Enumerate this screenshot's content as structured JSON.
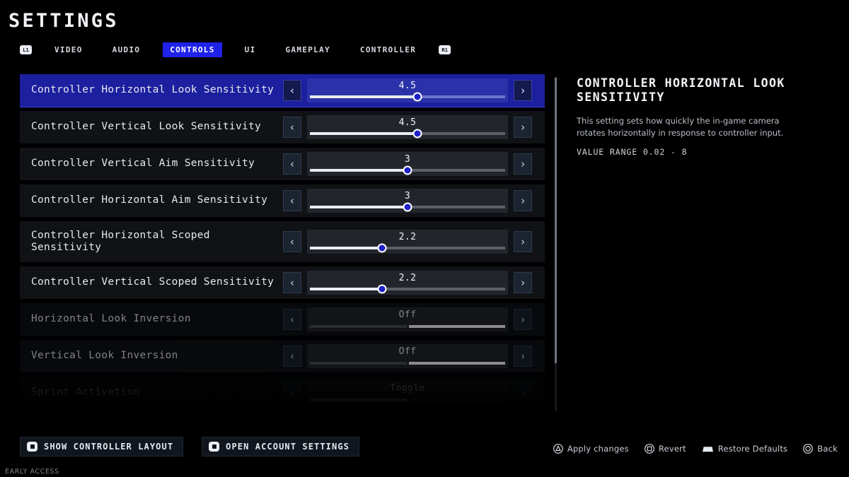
{
  "header": {
    "title": "SETTINGS",
    "left_bumper": "L1",
    "right_bumper": "R1",
    "tabs": [
      {
        "label": "VIDEO",
        "active": false
      },
      {
        "label": "AUDIO",
        "active": false
      },
      {
        "label": "CONTROLS",
        "active": true
      },
      {
        "label": "UI",
        "active": false
      },
      {
        "label": "GAMEPLAY",
        "active": false
      },
      {
        "label": "CONTROLLER",
        "active": false
      }
    ],
    "accent_color": "#1f22e8"
  },
  "settings": {
    "rows": [
      {
        "label": "Controller Horizontal Look Sensitivity",
        "value": "4.5",
        "control": "slider",
        "fill_percent": 55,
        "selected": true,
        "state": "normal",
        "two_line": false
      },
      {
        "label": "Controller Vertical Look Sensitivity",
        "value": "4.5",
        "control": "slider",
        "fill_percent": 55,
        "selected": false,
        "state": "normal",
        "two_line": false
      },
      {
        "label": "Controller Vertical Aim Sensitivity",
        "value": "3",
        "control": "slider",
        "fill_percent": 50,
        "selected": false,
        "state": "normal",
        "two_line": false
      },
      {
        "label": "Controller Horizontal Aim Sensitivity",
        "value": "3",
        "control": "slider",
        "fill_percent": 50,
        "selected": false,
        "state": "normal",
        "two_line": false
      },
      {
        "label": "Controller Horizontal Scoped Sensitivity",
        "value": "2.2",
        "control": "slider",
        "fill_percent": 37,
        "selected": false,
        "state": "normal",
        "two_line": true
      },
      {
        "label": "Controller Vertical Scoped Sensitivity",
        "value": "2.2",
        "control": "slider",
        "fill_percent": 37,
        "selected": false,
        "state": "normal",
        "two_line": false
      },
      {
        "label": "Horizontal Look Inversion",
        "value": "Off",
        "control": "segmented",
        "segments": 2,
        "active_segment": 1,
        "selected": false,
        "state": "dim",
        "two_line": false
      },
      {
        "label": "Vertical Look Inversion",
        "value": "Off",
        "control": "segmented",
        "segments": 2,
        "active_segment": 1,
        "selected": false,
        "state": "dim",
        "two_line": false
      },
      {
        "label": "Sprint Activation",
        "value": "Toggle",
        "control": "segmented",
        "segments": 2,
        "active_segment": 0,
        "selected": false,
        "state": "fading",
        "two_line": false
      }
    ],
    "prev_arrow": "‹",
    "next_arrow": "›"
  },
  "info": {
    "title": "CONTROLLER HORIZONTAL LOOK SENSITIVITY",
    "description": "This setting sets how quickly the in-game camera rotates horizontally in response to controller input.",
    "value_range": "VALUE RANGE 0.02 - 8"
  },
  "footer": {
    "buttons": [
      {
        "label": "SHOW CONTROLLER LAYOUT",
        "icon": "gamepad-button-icon"
      },
      {
        "label": "OPEN ACCOUNT SETTINGS",
        "icon": "gamepad-button-icon"
      }
    ],
    "hints": [
      {
        "label": "Apply changes",
        "icon": "triangle-button-icon"
      },
      {
        "label": "Revert",
        "icon": "square-button-icon"
      },
      {
        "label": "Restore Defaults",
        "icon": "touchpad-icon"
      },
      {
        "label": "Back",
        "icon": "circle-button-icon"
      }
    ]
  },
  "watermark": "EARLY ACCESS"
}
